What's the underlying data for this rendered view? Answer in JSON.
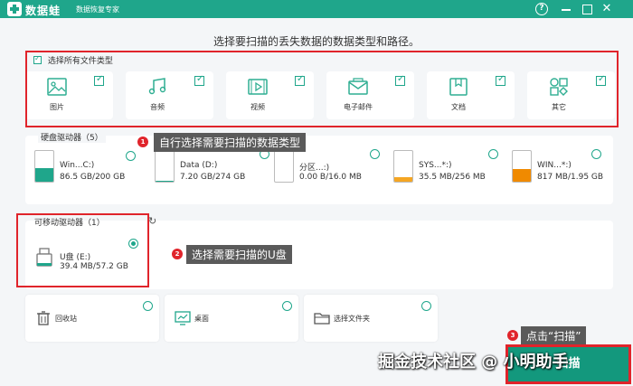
{
  "titlebar": {
    "app_name": "数据蛙",
    "subtitle": "数据恢复专家",
    "help": "?",
    "close": "✕"
  },
  "heading": "选择要扫描的丢失数据的数据类型和路径。",
  "file_types": {
    "select_all_label": "选择所有文件类型",
    "select_all_checked": true,
    "items": [
      {
        "label": "图片",
        "icon": "image-icon",
        "checked": true
      },
      {
        "label": "音频",
        "icon": "music-icon",
        "checked": true
      },
      {
        "label": "视频",
        "icon": "video-icon",
        "checked": true
      },
      {
        "label": "电子邮件",
        "icon": "email-icon",
        "checked": true
      },
      {
        "label": "文档",
        "icon": "document-icon",
        "checked": true
      },
      {
        "label": "其它",
        "icon": "other-icon",
        "checked": true
      }
    ]
  },
  "hard_drives": {
    "title": "硬盘驱动器（5）",
    "drives": [
      {
        "name": "Win...C:)",
        "size": "86.5 GB/200 GB",
        "usage": 0.43,
        "color": "#1fa68b"
      },
      {
        "name": "Data (D:)",
        "size": "7.20 GB/274 GB",
        "usage": 0.03,
        "color": "#1fa68b"
      },
      {
        "name": "分区...:)",
        "size": "0.00  B/16.0 MB",
        "usage": 0.0,
        "color": "#1fa68b"
      },
      {
        "name": "SYS...*:)",
        "size": "35.5 MB/256 MB",
        "usage": 0.14,
        "color": "#f5a623"
      },
      {
        "name": "WIN...*:)",
        "size": "817 MB/1.95 GB",
        "usage": 0.41,
        "color": "#f08a00"
      }
    ]
  },
  "removable": {
    "title": "可移动驱动器（1）",
    "drives": [
      {
        "name": "U盘 (E:)",
        "size": "39.4 MB/57.2 GB",
        "selected": true
      }
    ]
  },
  "locations": [
    {
      "label": "回收站",
      "icon": "recycle-bin-icon"
    },
    {
      "label": "桌面",
      "icon": "desktop-icon"
    },
    {
      "label": "选择文件夹",
      "icon": "folder-icon"
    }
  ],
  "callouts": [
    {
      "num": "1",
      "text": "自行选择需要扫描的数据类型"
    },
    {
      "num": "2",
      "text": "选择需要扫描的U盘"
    },
    {
      "num": "3",
      "text": "点击“扫描”"
    }
  ],
  "scan_button": "扫描",
  "watermark": "掘金技术社区 @ 小明助手",
  "colors": {
    "accent": "#1fa68b",
    "highlight": "#e0242b",
    "callout_bg": "#5a5a5a"
  }
}
